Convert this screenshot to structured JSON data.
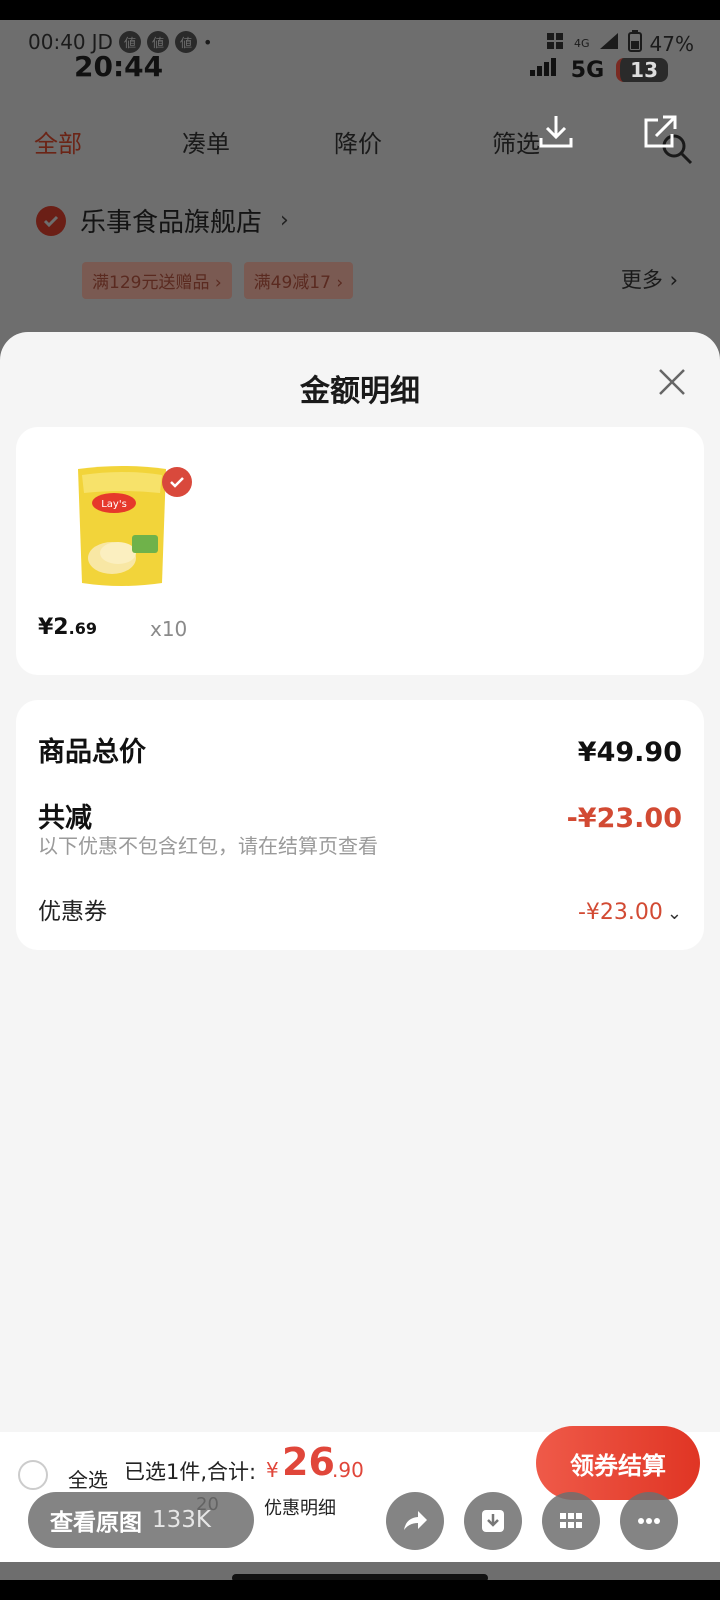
{
  "status_bar": {
    "left_top": "00:40",
    "carrier": "JD",
    "app_badge": "値",
    "clock": "20:44",
    "net_small": "4G",
    "battery": "47%",
    "network": "5G",
    "notification_count": "13"
  },
  "tabs": [
    {
      "label": "全部"
    },
    {
      "label": "凑单"
    },
    {
      "label": "降价"
    },
    {
      "label": "筛选"
    }
  ],
  "store": {
    "name": "乐事食品旗舰店",
    "chevron": "›",
    "promos": [
      "满129元送赠品 ›",
      "满49减17 ›"
    ],
    "more": "更多 ›"
  },
  "sheet": {
    "title": "金额明细",
    "product": {
      "price_int": "¥2",
      "price_dec": ".69",
      "qty": "x10"
    },
    "summary": {
      "goods_total_label": "商品总价",
      "goods_total_value": "¥49.90",
      "reduce_label": "共减",
      "reduce_value": "-¥23.00",
      "note": "以下优惠不包含红包，请在结算页查看",
      "coupon_label": "优惠券",
      "coupon_value": "-¥23.00",
      "caret": "⌄"
    }
  },
  "bottom_bar": {
    "select_all": "全选",
    "selected_text": "已选1件,合计:",
    "total_yen": "¥",
    "total_int": "26",
    "total_dec": ".90",
    "reduce_partial": "20",
    "detail_link": "优惠明细",
    "checkout": "领券结算"
  },
  "viewer": {
    "view_original": "查看原图",
    "size": "133K"
  },
  "colors": {
    "accent_red": "#e0463a",
    "reduce_red": "#d24a33",
    "sheet_bg": "#f5f5f5"
  }
}
